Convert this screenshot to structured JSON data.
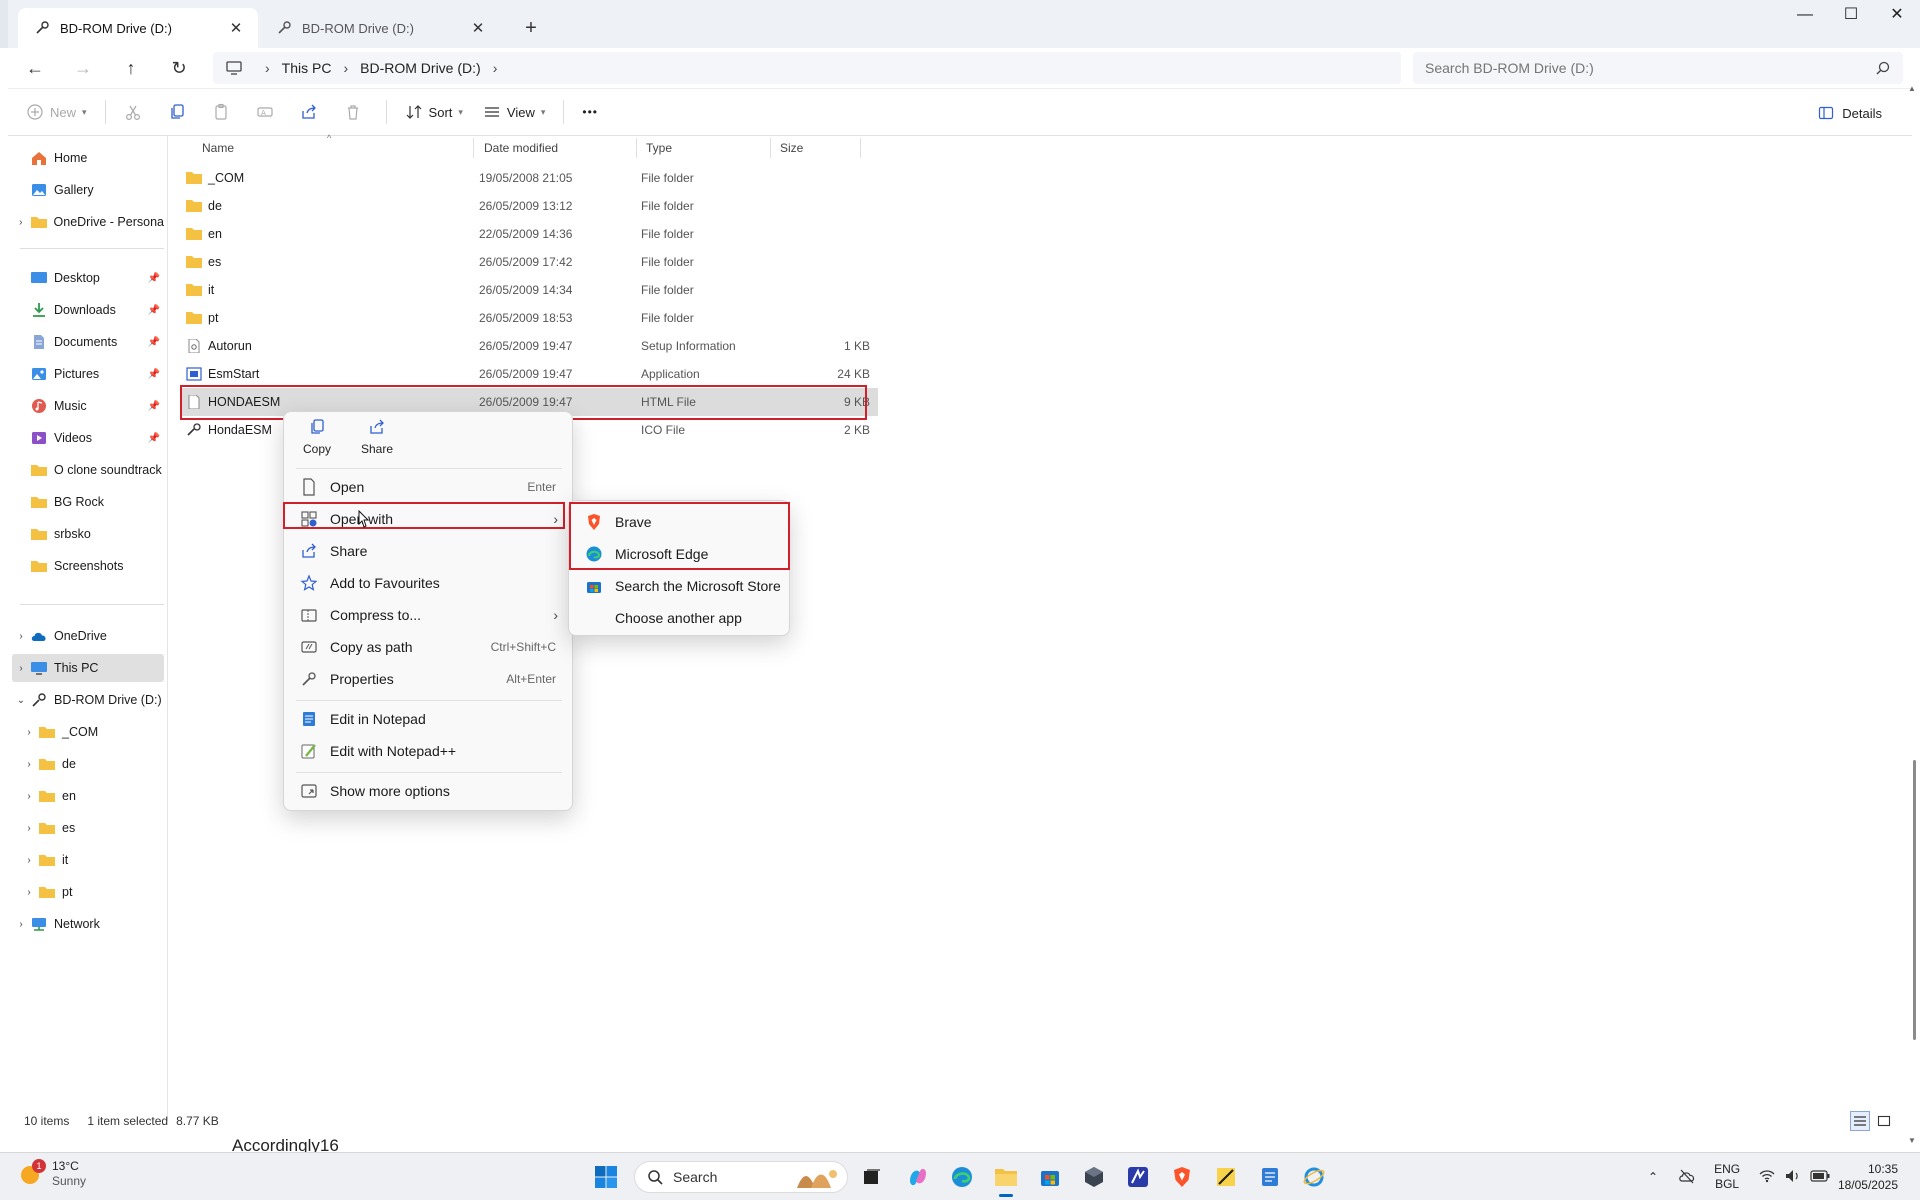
{
  "window": {
    "tabs": [
      {
        "label": "BD-ROM Drive (D:)",
        "active": true
      },
      {
        "label": "BD-ROM Drive (D:)",
        "active": false
      }
    ],
    "new_tab": "+",
    "controls": {
      "minimize": "—",
      "maximize": "☐",
      "close": "✕"
    }
  },
  "address": {
    "breadcrumbs": [
      "This PC",
      "BD-ROM Drive (D:)"
    ],
    "search_placeholder": "Search BD-ROM Drive (D:)"
  },
  "commands": {
    "new": "New",
    "sort": "Sort",
    "view": "View",
    "more": "•••",
    "details": "Details"
  },
  "sidebar": {
    "items": [
      {
        "label": "Home",
        "icon": "home-icon"
      },
      {
        "label": "Gallery",
        "icon": "gallery-icon"
      },
      {
        "label": "OneDrive - Persona",
        "icon": "folder-icon"
      },
      {
        "label": "Desktop",
        "icon": "desktop-icon"
      },
      {
        "label": "Downloads",
        "icon": "download-icon"
      },
      {
        "label": "Documents",
        "icon": "document-icon"
      },
      {
        "label": "Pictures",
        "icon": "pictures-icon"
      },
      {
        "label": "Music",
        "icon": "music-icon"
      },
      {
        "label": "Videos",
        "icon": "videos-icon"
      },
      {
        "label": "O clone soundtrack",
        "icon": "folder-icon"
      },
      {
        "label": "BG Rock",
        "icon": "folder-icon"
      },
      {
        "label": "srbsko",
        "icon": "folder-icon"
      },
      {
        "label": "Screenshots",
        "icon": "folder-icon"
      },
      {
        "label": "OneDrive",
        "icon": "cloud-icon"
      },
      {
        "label": "This PC",
        "icon": "computer-icon"
      },
      {
        "label": "BD-ROM Drive (D:)",
        "icon": "disc-drive-icon"
      },
      {
        "label": "_COM",
        "icon": "folder-icon"
      },
      {
        "label": "de",
        "icon": "folder-icon"
      },
      {
        "label": "en",
        "icon": "folder-icon"
      },
      {
        "label": "es",
        "icon": "folder-icon"
      },
      {
        "label": "it",
        "icon": "folder-icon"
      },
      {
        "label": "pt",
        "icon": "folder-icon"
      },
      {
        "label": "Network",
        "icon": "network-icon"
      }
    ]
  },
  "filelist": {
    "columns": {
      "name": "Name",
      "date": "Date modified",
      "type": "Type",
      "size": "Size"
    },
    "rows": [
      {
        "name": "_COM",
        "date": "19/05/2008 21:05",
        "type": "File folder",
        "size": ""
      },
      {
        "name": "de",
        "date": "26/05/2009 13:12",
        "type": "File folder",
        "size": ""
      },
      {
        "name": "en",
        "date": "22/05/2009 14:36",
        "type": "File folder",
        "size": ""
      },
      {
        "name": "es",
        "date": "26/05/2009 17:42",
        "type": "File folder",
        "size": ""
      },
      {
        "name": "it",
        "date": "26/05/2009 14:34",
        "type": "File folder",
        "size": ""
      },
      {
        "name": "pt",
        "date": "26/05/2009 18:53",
        "type": "File folder",
        "size": ""
      },
      {
        "name": "Autorun",
        "date": "26/05/2009 19:47",
        "type": "Setup Information",
        "size": "1 KB"
      },
      {
        "name": "EsmStart",
        "date": "26/05/2009 19:47",
        "type": "Application",
        "size": "24 KB"
      },
      {
        "name": "HONDAESM",
        "date": "26/05/2009 19:47",
        "type": "HTML File",
        "size": "9 KB"
      },
      {
        "name": "HondaESM",
        "date": "",
        "type": "ICO File",
        "size": "2 KB"
      }
    ]
  },
  "context_menu": {
    "quick": {
      "copy": "Copy",
      "share": "Share"
    },
    "items": [
      {
        "label": "Open",
        "shortcut": "Enter"
      },
      {
        "label": "Open with",
        "shortcut": ""
      },
      {
        "label": "Share",
        "shortcut": ""
      },
      {
        "label": "Add to Favourites",
        "shortcut": ""
      },
      {
        "label": "Compress to...",
        "shortcut": ""
      },
      {
        "label": "Copy as path",
        "shortcut": "Ctrl+Shift+C"
      },
      {
        "label": "Properties",
        "shortcut": "Alt+Enter"
      },
      {
        "label": "Edit in Notepad",
        "shortcut": ""
      },
      {
        "label": "Edit with Notepad++",
        "shortcut": ""
      },
      {
        "label": "Show more options",
        "shortcut": ""
      }
    ]
  },
  "open_with_menu": {
    "items": [
      "Brave",
      "Microsoft Edge",
      "Search the Microsoft Store",
      "Choose another app"
    ]
  },
  "status": {
    "count": "10 items",
    "selection": "1 item selected",
    "size": "8.77 KB",
    "underlying_window_text": "Accordingly16"
  },
  "taskbar": {
    "weather_temp": "13°C",
    "weather_desc": "Sunny",
    "weather_badge": "1",
    "search_label": "Search",
    "lang_top": "ENG",
    "lang_bottom": "BGL",
    "time": "10:35",
    "date": "18/05/2025"
  },
  "colors": {
    "highlight": "#d0202a",
    "folder": "#f5c142",
    "accent": "#0067c0"
  }
}
